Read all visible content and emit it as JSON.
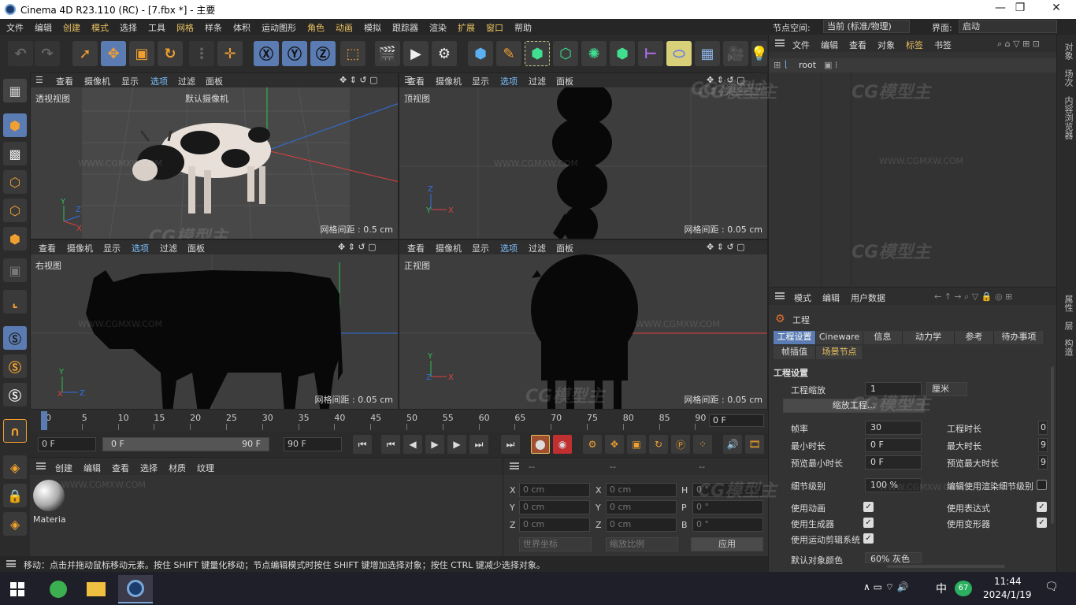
{
  "window": {
    "title": "Cinema 4D R23.110 (RC) - [7.fbx *] - 主要",
    "min": "—",
    "max": "❐",
    "close": "✕"
  },
  "menu": [
    "文件",
    "编辑",
    "创建",
    "模式",
    "选择",
    "工具",
    "网格",
    "样条",
    "体积",
    "运动图形",
    "角色",
    "动画",
    "模拟",
    "跟踪器",
    "渲染",
    "扩展",
    "窗口",
    "帮助"
  ],
  "topright": {
    "node_space_label": "节点空间:",
    "node_space_value": "当前 (标准/物理)",
    "layout_label": "界面:",
    "layout_value": "启动"
  },
  "viewport_menu": [
    "查看",
    "摄像机",
    "显示",
    "选项",
    "过滤",
    "面板"
  ],
  "viewports": [
    {
      "name": "透视视图",
      "camera": "默认摄像机",
      "grid": "网格间距 : 0.5 cm",
      "axes": [
        "Y",
        "Z",
        "X"
      ]
    },
    {
      "name": "顶视图",
      "grid": "网格间距 : 0.05 cm",
      "axes": [
        "Z",
        "Y",
        "X"
      ]
    },
    {
      "name": "右视图",
      "grid": "网格间距 : 0.05 cm",
      "axes": [
        "Y",
        "X",
        "Z"
      ]
    },
    {
      "name": "正视图",
      "grid": "网格间距 : 0.05 cm",
      "axes": [
        "Y",
        "Z",
        "X"
      ]
    }
  ],
  "timeline": {
    "ticks": [
      "0",
      "5",
      "10",
      "15",
      "20",
      "25",
      "30",
      "35",
      "40",
      "45",
      "50",
      "55",
      "60",
      "65",
      "70",
      "75",
      "80",
      "85",
      "90"
    ],
    "end_frame": "0 F"
  },
  "transport": {
    "current": "0 F",
    "range_start": "0 F",
    "range_end": "90 F",
    "max": "90 F"
  },
  "material_manager": {
    "menu": [
      "创建",
      "编辑",
      "查看",
      "选择",
      "材质",
      "纹理"
    ],
    "material_name": "Materia"
  },
  "coordinates": {
    "header": [
      "--",
      "--",
      "--"
    ],
    "rows": [
      {
        "a": "X",
        "av": "0 cm",
        "b": "X",
        "bv": "0 cm",
        "c": "H",
        "cv": "0 °"
      },
      {
        "a": "Y",
        "av": "0 cm",
        "b": "Y",
        "bv": "0 cm",
        "c": "P",
        "cv": "0 °"
      },
      {
        "a": "Z",
        "av": "0 cm",
        "b": "Z",
        "bv": "0 cm",
        "c": "B",
        "cv": "0 °"
      }
    ],
    "world": "世界坐标",
    "scale": "缩放比例",
    "apply": "应用"
  },
  "status": "移动：点击并拖动鼠标移动元素。按住 SHIFT 键量化移动；节点编辑模式时按住 SHIFT 键增加选择对象；按住 CTRL 键减少选择对象。",
  "object_manager": {
    "menu": [
      "文件",
      "编辑",
      "查看",
      "对象",
      "标签",
      "书签"
    ],
    "root": "root"
  },
  "attributes": {
    "menu": [
      "模式",
      "编辑",
      "用户数据"
    ],
    "title": "工程",
    "tabs": [
      "工程设置",
      "Cineware",
      "信息",
      "动力学",
      "参考",
      "待办事项"
    ],
    "tabs2": [
      "帧插值",
      "场景节点"
    ],
    "section": "工程设置",
    "scale_label": "工程缩放",
    "scale_value": "1",
    "scale_unit": "厘米",
    "scale_btn": "缩放工程...",
    "fps_label": "帧率",
    "fps_value": "30",
    "duration_label": "工程时长",
    "duration_value": "0",
    "min_label": "最小时长",
    "min_value": "0 F",
    "max_label": "最大时长",
    "max_value": "9",
    "pmin_label": "预览最小时长",
    "pmin_value": "0 F",
    "pmax_label": "预览最大时长",
    "pmax_value": "9",
    "lod_label": "细节级别",
    "lod_value": "100 %",
    "lod_render": "编辑使用渲染细节级别",
    "anim": "使用动画",
    "expr": "使用表达式",
    "gen": "使用生成器",
    "deform": "使用变形器",
    "motion": "使用运动剪辑系统",
    "defcolor_label": "默认对象颜色",
    "defcolor_value": "60% 灰色"
  },
  "side_tabs": [
    "对象",
    "场次",
    "内容浏览器",
    "属性",
    "层",
    "构造"
  ],
  "taskbar": {
    "time": "11:44",
    "date": "2024/1/19",
    "ime": "中",
    "badge": "67"
  },
  "watermark": {
    "logo": "CG模型主",
    "url": "WWW.CGMXW.COM"
  }
}
